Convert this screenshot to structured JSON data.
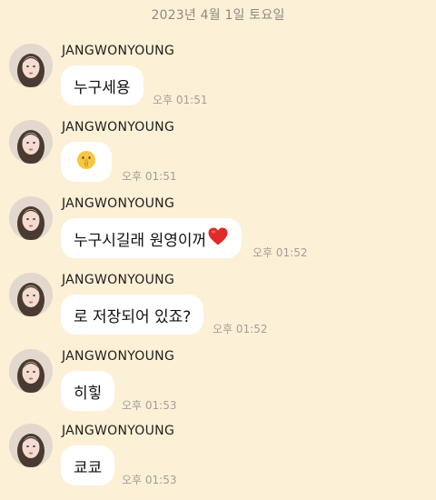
{
  "date_header": "2023년 4월 1일 토요일",
  "colors": {
    "background": "#fcf0d6",
    "bubble": "#ffffff",
    "heart": "#e02a2a"
  },
  "messages": [
    {
      "sender": "JANGWONYOUNG",
      "text": "누구세용",
      "time": "오후 01:51"
    },
    {
      "sender": "JANGWONYOUNG",
      "text": "",
      "icon": "shushing-face-emoji",
      "time": "오후 01:51"
    },
    {
      "sender": "JANGWONYOUNG",
      "text": "누구시길래 원영이꺼",
      "icon": "red-heart-emoji",
      "time": "오후 01:52"
    },
    {
      "sender": "JANGWONYOUNG",
      "text": "로 저장되어 있죠?",
      "time": "오후 01:52"
    },
    {
      "sender": "JANGWONYOUNG",
      "text": "히힣",
      "time": "오후 01:53"
    },
    {
      "sender": "JANGWONYOUNG",
      "text": "쿄쿄",
      "time": "오후 01:53"
    }
  ]
}
